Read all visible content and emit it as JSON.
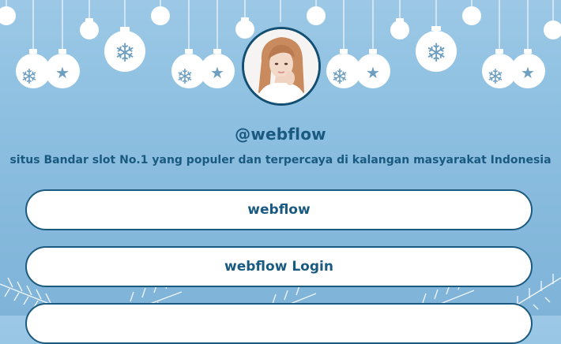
{
  "profile": {
    "handle": "@webflow",
    "bio": "situs Bandar slot No.1 yang populer dan terpercaya di kalangan masyarakat Indonesia",
    "avatar_alt": "profile photo"
  },
  "links": [
    {
      "label": "webflow"
    },
    {
      "label": "webflow Login"
    },
    {
      "label": ""
    }
  ],
  "theme": {
    "background_top": "#9cc8e6",
    "background_bottom": "#7fb3d8",
    "accent": "#1b5a80",
    "button_bg": "#ffffff"
  },
  "decorations": {
    "ornament_icons": [
      "snowflake-icon",
      "star-icon"
    ],
    "bottom": "pine-branches"
  }
}
